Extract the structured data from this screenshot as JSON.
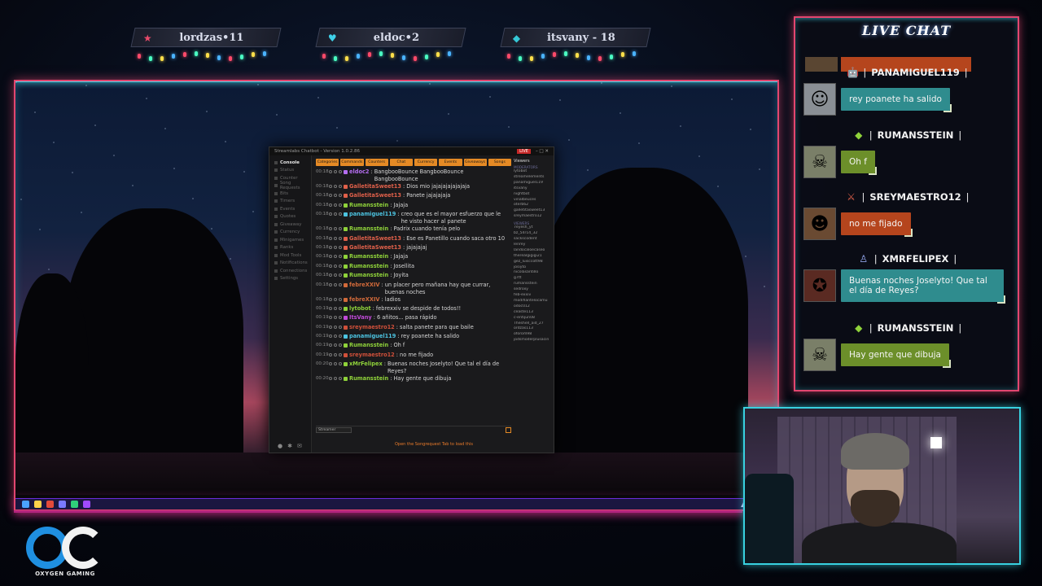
{
  "follow_bars": [
    {
      "name": "lordzas",
      "value": "11",
      "icon": "star-icon",
      "color": "#e94a6a"
    },
    {
      "name": "eldoc",
      "value": "2",
      "icon": "heart-icon",
      "color": "#3fd0e8"
    },
    {
      "name": "itsvany",
      "value": "18",
      "icon": "diamond-icon",
      "color": "#35c7d6"
    }
  ],
  "follow_labels": [
    "lordzas•11",
    "eldoc•2",
    "itsvany - 18"
  ],
  "chatbot": {
    "title": "Streamlabs Chatbot - Version 1.0.2.86",
    "live_badge": "LIVE",
    "sidebar": [
      "Console",
      "Status",
      "Counter",
      "Song Requests",
      "Bits",
      "Timers",
      "Events",
      "Quotes",
      "Giveaway",
      "Currency",
      "Minigames",
      "Ranks",
      "Mod Tools",
      "Notifications",
      "Connections",
      "Settings"
    ],
    "tabs": [
      "Categories",
      "Commands",
      "Counters",
      "Chat Triggers",
      "Currency",
      "Events",
      "Giveaways",
      "Songs"
    ],
    "messages": [
      {
        "time": "00:18",
        "user": "eldoc2",
        "ucolor": "#b46df0",
        "text": "BangbooBounce BangbooBounce BangbooBounce"
      },
      {
        "time": "00:18",
        "user": "GalletitaSweet13",
        "ucolor": "#e0604a",
        "text": "Dios mio jajajajajajajaja"
      },
      {
        "time": "00:18",
        "user": "GalletitaSweet13",
        "ucolor": "#e0604a",
        "text": "Panete jajajajaja"
      },
      {
        "time": "00:18",
        "user": "Rumansstein",
        "ucolor": "#8fd23a",
        "text": "Jajaja"
      },
      {
        "time": "00:18",
        "user": "panamiguel119",
        "ucolor": "#4cc3e0",
        "text": "creo que es el mayor esfuerzo que le he visto hacer al panete"
      },
      {
        "time": "00:18",
        "user": "Rumansstein",
        "ucolor": "#8fd23a",
        "text": "Padrix cuando tenía pelo"
      },
      {
        "time": "00:18",
        "user": "GalletitaSweet13",
        "ucolor": "#e0604a",
        "text": "Ese es Panetillo cuando saca otro 10"
      },
      {
        "time": "00:18",
        "user": "GalletitaSweet13",
        "ucolor": "#e0604a",
        "text": "jajajajaj"
      },
      {
        "time": "00:18",
        "user": "Rumansstein",
        "ucolor": "#8fd23a",
        "text": "Jajaja"
      },
      {
        "time": "00:18",
        "user": "Rumansstein",
        "ucolor": "#8fd23a",
        "text": "Josellita"
      },
      {
        "time": "00:18",
        "user": "Rumansstein",
        "ucolor": "#8fd23a",
        "text": "Joyita"
      },
      {
        "time": "00:18",
        "user": "febreXXIV",
        "ucolor": "#d26a3a",
        "text": "un placer pero mañana hay que currar, buenas noches"
      },
      {
        "time": "00:18",
        "user": "febreXXIV",
        "ucolor": "#d26a3a",
        "text": "ladios"
      },
      {
        "time": "00:19",
        "user": "lytobot",
        "ucolor": "#8fd23a",
        "text": "febrexxiv se despide de todos!!"
      },
      {
        "time": "00:19",
        "user": "ItsVany",
        "ucolor": "#c04ad8",
        "text": "6 añitos... pasa rápido"
      },
      {
        "time": "00:19",
        "user": "sreymaestro12",
        "ucolor": "#d0503a",
        "text": "salta panete para que baile"
      },
      {
        "time": "00:19",
        "user": "panamiguel119",
        "ucolor": "#4cc3e0",
        "text": "rey poanete ha salido"
      },
      {
        "time": "00:19",
        "user": "Rumansstein",
        "ucolor": "#8fd23a",
        "text": "Oh f"
      },
      {
        "time": "00:19",
        "user": "sreymaestro12",
        "ucolor": "#d0503a",
        "text": "no me fijado"
      },
      {
        "time": "00:20",
        "user": "xMrFelipex",
        "ucolor": "#8fd23a",
        "text": "Buenas noches Joselyto! Que tal el día de Reyes?"
      },
      {
        "time": "00:20",
        "user": "Rumansstein",
        "ucolor": "#8fd23a",
        "text": "Hay gente que dibuja"
      }
    ],
    "input_select": "Streamer",
    "footer_note": "Open the Songrequest Tab to load this",
    "viewers_title": "Viewers",
    "viewers_section_mods": "MODERATORS",
    "viewers_section_viewers": "VIEWERS",
    "moderators": [
      "lytobot",
      "streamelements",
      "panamiguel119",
      "itsvany",
      "nightbot",
      "vinalbeuces",
      "oterb62",
      "galletitasweet13",
      "sreymaestro12"
    ],
    "viewers": [
      "7eyesh_yt",
      "bz_54r14_32",
      "sackscodent",
      "lenrey",
      "landocaloecaseo",
      "therealgigigi21",
      "gez_luisccott98",
      "josiyto",
      "nicolasantillo",
      "g7tt",
      "rumansstein",
      "sedroxy",
      "feb-exxiv",
      "modifiantelocamu",
      "odoc012",
      "ceaste113",
      "c-entijun08",
      "Theshell_aid_27",
      "ordzas113",
      "oforom98",
      "jodsmoderplusacin"
    ]
  },
  "live_chat": {
    "title": "LIVE CHAT",
    "entries": [
      {
        "user": "PANAMIGUEL119",
        "badge": "robot-icon",
        "message": "rey poanete ha salido",
        "bubble": "teal",
        "avatar": "photo-avatar"
      },
      {
        "user": "RUMANSSTEIN",
        "badge": "diamond-icon",
        "message": "Oh f",
        "bubble": "olive",
        "avatar": "skull-avatar"
      },
      {
        "user": "SREYMAESTRO12",
        "badge": "sword-icon",
        "message": "no me fijado",
        "bubble": "rust",
        "avatar": "face-avatar"
      },
      {
        "user": "XMRFELIPEX",
        "badge": "user-icon",
        "message": "Buenas noches Joselyto! Que tal el día de Reyes?",
        "bubble": "teal",
        "avatar": "emblem-avatar"
      },
      {
        "user": "RUMANSSTEIN",
        "badge": "diamond-icon",
        "message": "Hay gente que dibuja",
        "bubble": "olive",
        "avatar": "skull-avatar"
      }
    ]
  },
  "logo": {
    "brand": "OXYGEN GAMING"
  },
  "colors": {
    "accent_pink": "#e2466f",
    "accent_cyan": "#48d6e7",
    "bot_orange": "#e58a25"
  }
}
